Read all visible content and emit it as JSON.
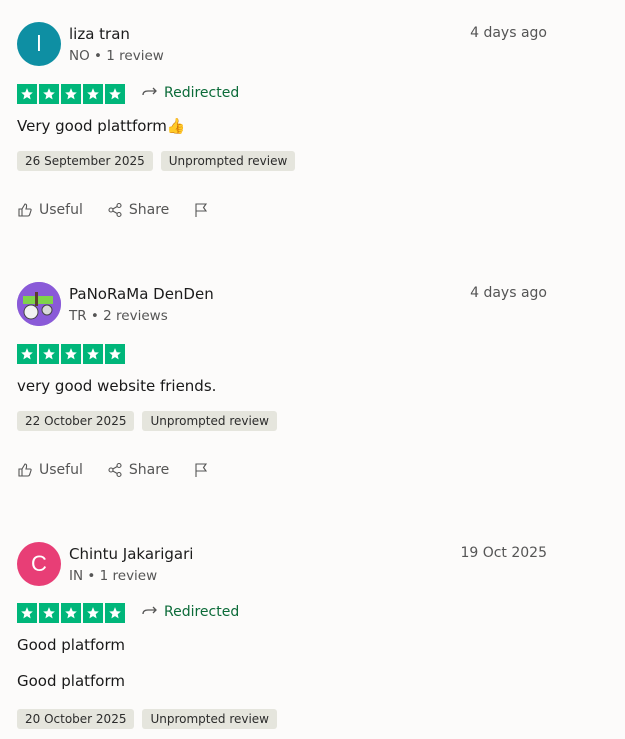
{
  "reviews": [
    {
      "avatar_letter": "l",
      "avatar_color": "#0e8fa3",
      "name": "liza tran",
      "meta": "NO • 1 review",
      "date": "4 days ago",
      "rating": 5,
      "redirected": "Redirected",
      "title": "Very good plattform👍",
      "body": "",
      "tags": [
        "26 September 2025",
        "Unprompted review"
      ],
      "actions": {
        "useful": "Useful",
        "share": "Share"
      }
    },
    {
      "avatar_letter": "",
      "avatar_color": "#7c4fd1",
      "name": "PaNoRaMa DenDen",
      "meta": "TR • 2 reviews",
      "date": "4 days ago",
      "rating": 5,
      "redirected": "",
      "title": "very good website friends.",
      "body": "",
      "tags": [
        "22 October 2025",
        "Unprompted review"
      ],
      "actions": {
        "useful": "Useful",
        "share": "Share"
      }
    },
    {
      "avatar_letter": "C",
      "avatar_color": "#e83e76",
      "name": "Chintu Jakarigari",
      "meta": "IN • 1 review",
      "date": "19 Oct 2025",
      "rating": 5,
      "redirected": "Redirected",
      "title": "Good platform",
      "body": "Good platform",
      "tags": [
        "20 October 2025",
        "Unprompted review"
      ],
      "actions": {
        "useful": "",
        "share": ""
      }
    }
  ],
  "colors": {
    "star_green": "#00b67a",
    "redirected_green": "#0c6b39",
    "tag_bg": "#e5e5dd"
  }
}
